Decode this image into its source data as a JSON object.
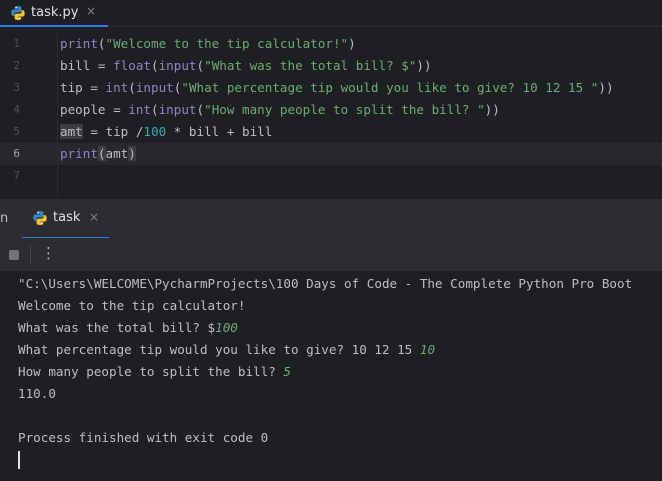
{
  "editor": {
    "tab": {
      "label": "task.py",
      "close": "×",
      "icon": "python-icon"
    },
    "lines": [
      {
        "num": "1",
        "tokens": [
          {
            "t": "print",
            "c": "kw"
          },
          {
            "t": "(",
            "c": "plain"
          },
          {
            "t": "\"Welcome to the tip calculator!\"",
            "c": "str"
          },
          {
            "t": ")",
            "c": "plain"
          }
        ]
      },
      {
        "num": "2",
        "tokens": [
          {
            "t": "bill = ",
            "c": "plain"
          },
          {
            "t": "float",
            "c": "kw"
          },
          {
            "t": "(",
            "c": "plain"
          },
          {
            "t": "input",
            "c": "kw"
          },
          {
            "t": "(",
            "c": "plain"
          },
          {
            "t": "\"What was the total bill? $\"",
            "c": "str"
          },
          {
            "t": "))",
            "c": "plain"
          }
        ]
      },
      {
        "num": "3",
        "tokens": [
          {
            "t": "tip = ",
            "c": "plain"
          },
          {
            "t": "int",
            "c": "kw"
          },
          {
            "t": "(",
            "c": "plain"
          },
          {
            "t": "input",
            "c": "kw"
          },
          {
            "t": "(",
            "c": "plain"
          },
          {
            "t": "\"What percentage tip would you like to give? 10 12 15 \"",
            "c": "str"
          },
          {
            "t": "))",
            "c": "plain"
          }
        ]
      },
      {
        "num": "4",
        "tokens": [
          {
            "t": "people = ",
            "c": "plain"
          },
          {
            "t": "int",
            "c": "kw"
          },
          {
            "t": "(",
            "c": "plain"
          },
          {
            "t": "input",
            "c": "kw"
          },
          {
            "t": "(",
            "c": "plain"
          },
          {
            "t": "\"How many people to split the bill? \"",
            "c": "str"
          },
          {
            "t": "))",
            "c": "plain"
          }
        ]
      },
      {
        "num": "5",
        "tokens": [
          {
            "t": "amt",
            "c": "plain hl-var"
          },
          {
            "t": " = tip /",
            "c": "plain"
          },
          {
            "t": "100",
            "c": "num"
          },
          {
            "t": " * bill + bill",
            "c": "plain"
          }
        ]
      },
      {
        "num": "6",
        "current": true,
        "tokens": [
          {
            "t": "print",
            "c": "kw"
          },
          {
            "t": "(",
            "c": "plain hl-paren"
          },
          {
            "t": "amt",
            "c": "plain"
          },
          {
            "t": ")",
            "c": "plain hl-paren"
          }
        ]
      },
      {
        "num": "7",
        "tokens": []
      }
    ]
  },
  "run_panel": {
    "prev_tab_label": "n",
    "tab": {
      "label": "task",
      "close": "×",
      "icon": "python-icon"
    },
    "toolbar": {
      "stop": "stop-icon",
      "more": "⋮"
    }
  },
  "console": {
    "lines": [
      {
        "text": "\"C:\\Users\\WELCOME\\PycharmProjects\\100 Days of Code - The Complete Python Pro Boot",
        "input": ""
      },
      {
        "text": "Welcome to the tip calculator!",
        "input": ""
      },
      {
        "text": "What was the total bill? $",
        "input": "100"
      },
      {
        "text": "What percentage tip would you like to give? 10 12 15 ",
        "input": "10"
      },
      {
        "text": "How many people to split the bill? ",
        "input": "5"
      },
      {
        "text": "110.0",
        "input": ""
      },
      {
        "text": "",
        "input": ""
      },
      {
        "text": "Process finished with exit code 0",
        "input": ""
      }
    ]
  },
  "colors": {
    "background": "#1e1f22",
    "panel": "#2b2d30",
    "keyword": "#8888c6",
    "string": "#6aab73",
    "number": "#2aacb8",
    "accent": "#3574f0"
  }
}
